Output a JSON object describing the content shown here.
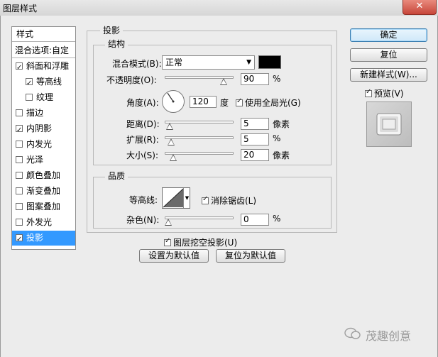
{
  "window": {
    "title": "图层样式",
    "close_glyph": "✕"
  },
  "left_panel": {
    "header": "样式",
    "blend_options": "混合选项:自定",
    "items": [
      {
        "label": "斜面和浮雕",
        "checked": true,
        "indent": false,
        "selected": false
      },
      {
        "label": "等高线",
        "checked": true,
        "indent": true,
        "selected": false
      },
      {
        "label": "纹理",
        "checked": false,
        "indent": true,
        "selected": false
      },
      {
        "label": "描边",
        "checked": false,
        "indent": false,
        "selected": false
      },
      {
        "label": "内阴影",
        "checked": true,
        "indent": false,
        "selected": false
      },
      {
        "label": "内发光",
        "checked": false,
        "indent": false,
        "selected": false
      },
      {
        "label": "光泽",
        "checked": false,
        "indent": false,
        "selected": false
      },
      {
        "label": "颜色叠加",
        "checked": false,
        "indent": false,
        "selected": false
      },
      {
        "label": "渐变叠加",
        "checked": false,
        "indent": false,
        "selected": false
      },
      {
        "label": "图案叠加",
        "checked": false,
        "indent": false,
        "selected": false
      },
      {
        "label": "外发光",
        "checked": false,
        "indent": false,
        "selected": false
      },
      {
        "label": "投影",
        "checked": true,
        "indent": false,
        "selected": true
      }
    ]
  },
  "drop_shadow": {
    "title": "投影",
    "structure": {
      "title": "结构",
      "blend_mode_label": "混合模式(B):",
      "blend_mode_value": "正常",
      "color": "#000000",
      "opacity_label": "不透明度(O):",
      "opacity_value": "90",
      "opacity_unit": "%",
      "opacity_fraction": 0.9,
      "angle_label": "角度(A):",
      "angle_value": "120",
      "angle_unit": "度",
      "global_light_label": "使用全局光(G)",
      "global_light_checked": true,
      "distance_label": "距离(D):",
      "distance_value": "5",
      "distance_unit": "像素",
      "distance_fraction": 0.02,
      "spread_label": "扩展(R):",
      "spread_value": "5",
      "spread_unit": "%",
      "spread_fraction": 0.05,
      "size_label": "大小(S):",
      "size_value": "20",
      "size_unit": "像素",
      "size_fraction": 0.08
    },
    "quality": {
      "title": "品质",
      "contour_label": "等高线:",
      "antialias_label": "消除锯齿(L)",
      "antialias_checked": true,
      "noise_label": "杂色(N):",
      "noise_value": "0",
      "noise_unit": "%",
      "noise_fraction": 0
    },
    "knockout_label": "图层挖空投影(U)",
    "knockout_checked": true,
    "make_default": "设置为默认值",
    "reset_default": "复位为默认值"
  },
  "right_buttons": {
    "ok": "确定",
    "reset": "复位",
    "new_style": "新建样式(W)...",
    "preview_label": "预览(V)",
    "preview_checked": true
  },
  "watermark": "茂趣创意"
}
